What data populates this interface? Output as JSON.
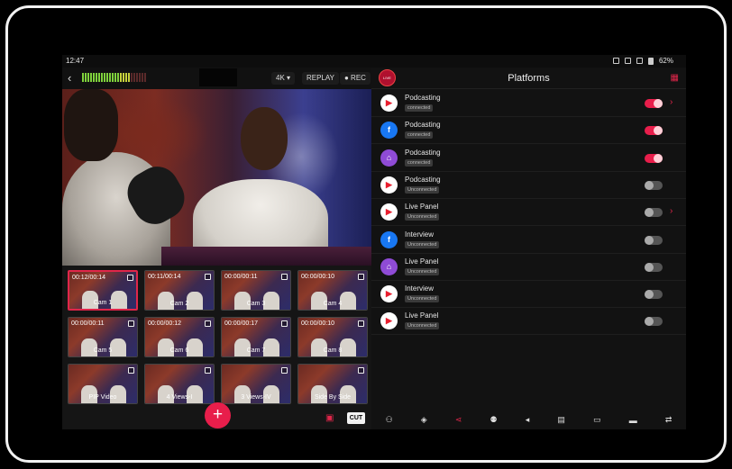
{
  "status": {
    "time": "12:47",
    "battery": "62%"
  },
  "left": {
    "quality": "4K ▾",
    "replay": "REPLAY",
    "rec": "● REC",
    "thumbs": [
      {
        "time": "00:12/00:14",
        "label": "Cam 1",
        "active": true
      },
      {
        "time": "00:11/00:14",
        "label": "Cam 2"
      },
      {
        "time": "00:00/00:11",
        "label": "Cam 3"
      },
      {
        "time": "00:00/00:10",
        "label": "Cam 4"
      },
      {
        "time": "00:00/00:11",
        "label": "Cam 5"
      },
      {
        "time": "00:00/00:12",
        "label": "Cam 6"
      },
      {
        "time": "00:00/00:17",
        "label": "Cam 7"
      },
      {
        "time": "00:00/00:10",
        "label": "Cam 8"
      },
      {
        "time": "",
        "label": "PIP Video"
      },
      {
        "time": "",
        "label": "4 Views-I"
      },
      {
        "time": "",
        "label": "3 Views-IV"
      },
      {
        "time": "",
        "label": "Side By Side"
      }
    ],
    "fab": "+",
    "cut": "CUT"
  },
  "right": {
    "title": "Platforms",
    "platforms": [
      {
        "icon": "youtube-icon",
        "name": "Podcasting",
        "status": "connected",
        "on": true,
        "chevron": true
      },
      {
        "icon": "facebook-icon",
        "name": "Podcasting",
        "status": "connected",
        "on": true,
        "chevron": false
      },
      {
        "icon": "twitch-icon",
        "name": "Podcasting",
        "status": "connected",
        "on": true,
        "chevron": false
      },
      {
        "icon": "play-icon",
        "name": "Podcasting",
        "status": "Unconnected",
        "on": false,
        "chevron": false
      },
      {
        "icon": "youtube-icon",
        "name": "Live Panel",
        "status": "Unconnected",
        "on": false,
        "chevron": true
      },
      {
        "icon": "facebook-icon",
        "name": "Interview",
        "status": "Unconnected",
        "on": false,
        "chevron": false
      },
      {
        "icon": "twitch-icon",
        "name": "Live Panel",
        "status": "Unconnected",
        "on": false,
        "chevron": false
      },
      {
        "icon": "play-icon",
        "name": "Interview",
        "status": "Unconnected",
        "on": false,
        "chevron": false
      },
      {
        "icon": "play-icon",
        "name": "Live Panel",
        "status": "Unconnected",
        "on": false,
        "chevron": false
      }
    ],
    "nav": [
      "scene-icon",
      "layers-icon",
      "share-icon",
      "guests-icon",
      "audio-icon",
      "calendar-icon",
      "camera-icon",
      "chat-icon",
      "switch-icon"
    ]
  },
  "colors": {
    "accent": "#e81e4b",
    "youtube": "#e81e2e",
    "facebook": "#1877f2",
    "twitch": "#8f4bd6"
  }
}
